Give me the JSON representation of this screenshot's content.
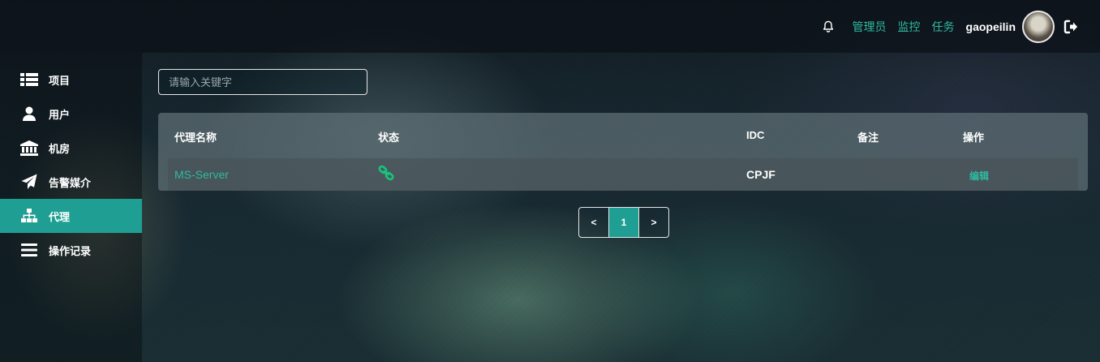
{
  "header": {
    "links": [
      "管理员",
      "监控",
      "任务"
    ],
    "username": "gaopeilin"
  },
  "sidebar": {
    "items": [
      {
        "label": "项目",
        "icon": "th-list-icon"
      },
      {
        "label": "用户",
        "icon": "user-icon"
      },
      {
        "label": "机房",
        "icon": "bank-icon"
      },
      {
        "label": "告警媒介",
        "icon": "paper-plane-icon"
      },
      {
        "label": "代理",
        "icon": "sitemap-icon",
        "active": true
      },
      {
        "label": "操作记录",
        "icon": "bars-icon"
      }
    ]
  },
  "search": {
    "placeholder": "请输入关键字",
    "value": ""
  },
  "table": {
    "headers": [
      "代理名称",
      "状态",
      "IDC",
      "备注",
      "操作"
    ],
    "rows": [
      {
        "name": "MS-Server",
        "status_icon": "link-icon",
        "idc": "CPJF",
        "remark": "",
        "action": "编辑"
      }
    ]
  },
  "pagination": {
    "prev": "<",
    "current": "1",
    "next": ">"
  },
  "colors": {
    "accent": "#1f9f93",
    "link": "#2fb9a0",
    "status_ok": "#19c37d"
  }
}
